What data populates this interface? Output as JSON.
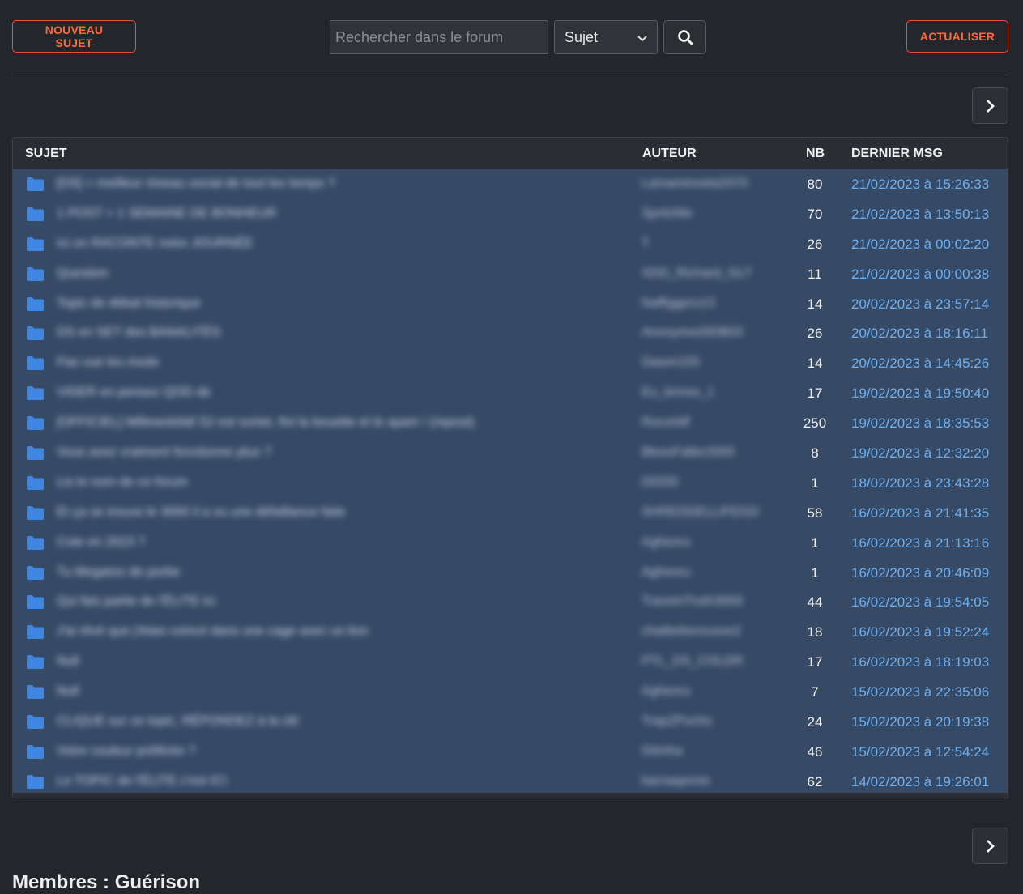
{
  "toolbar": {
    "new_topic_label": "Nouveau sujet",
    "search_placeholder": "Rechercher dans le forum",
    "search_select_value": "Sujet",
    "refresh_label": "Actualiser"
  },
  "table": {
    "headers": {
      "subject": "Sujet",
      "author": "Auteur",
      "count": "NB",
      "last": "Dernier MSG"
    },
    "rows": [
      {
        "subject": "[DS] = meilleur réseau social de tout les temps ?",
        "author": "Lamaminnela2070",
        "count": "80",
        "last": "21/02/2023 à 15:26:33"
      },
      {
        "subject": "1 POST = 1 SEMAINE DE BONHEUR",
        "author": "SpritzMe",
        "count": "70",
        "last": "21/02/2023 à 13:50:13"
      },
      {
        "subject": "Ici on RACONTE notre JOURNÉE",
        "author": "T",
        "count": "26",
        "last": "21/02/2023 à 00:02:20"
      },
      {
        "subject": "Question",
        "author": "XDD_Richard_GLT",
        "count": "11",
        "last": "21/02/2023 à 00:00:38"
      },
      {
        "subject": "Topic de débat historique",
        "author": "Naffiggers13",
        "count": "14",
        "last": "20/02/2023 à 23:57:14"
      },
      {
        "subject": "DS en SET des BANALITÉS",
        "author": "Anonymed3DB03",
        "count": "26",
        "last": "20/02/2023 à 18:16:11"
      },
      {
        "subject": "Pas vue les mods",
        "author": "Dawm155",
        "count": "14",
        "last": "20/02/2023 à 14:45:26"
      },
      {
        "subject": "VIDER en pensez QOD de",
        "author": "Eu_brmss_1",
        "count": "17",
        "last": "19/02/2023 à 19:50:40"
      },
      {
        "subject": "[OFFICIEL] Millewolsfall S2 est sortet, fini la bouette et le spam ! (repost)",
        "author": "Rocorldf",
        "count": "250",
        "last": "19/02/2023 à 18:35:53"
      },
      {
        "subject": "Vous avez vraiment fonctionne plus ?",
        "author": "BlessFaller2000",
        "count": "8",
        "last": "19/02/2023 à 12:32:20"
      },
      {
        "subject": "Lis le nom de ce forum",
        "author": "DDDD",
        "count": "1",
        "last": "18/02/2023 à 23:43:28"
      },
      {
        "subject": "Et ça se trouve le 3000 il a vu une défaillance faite",
        "author": "SHREDDELLIFEGD",
        "count": "58",
        "last": "16/02/2023 à 21:41:35"
      },
      {
        "subject": "Cote en 2023 ?",
        "author": "Agheoru",
        "count": "1",
        "last": "16/02/2023 à 21:13:16"
      },
      {
        "subject": "Tu Megatoo de porbe",
        "author": "Agheoru",
        "count": "1",
        "last": "16/02/2023 à 20:46:09"
      },
      {
        "subject": "Qui fais partie de l'ÉLITE ici",
        "author": "TraveinTruth3000",
        "count": "44",
        "last": "16/02/2023 à 19:54:05"
      },
      {
        "subject": "J'ai rêvé que j'étais coincé dans une cage avec un lion",
        "author": "chatbeberousse2",
        "count": "18",
        "last": "16/02/2023 à 19:52:24"
      },
      {
        "subject": "Null",
        "author": "PTL_DS_COLDR",
        "count": "17",
        "last": "16/02/2023 à 18:19:03"
      },
      {
        "subject": "Null",
        "author": "Agheoru",
        "count": "7",
        "last": "15/02/2023 à 22:35:06"
      },
      {
        "subject": "CLIQUE sur ce topic, RÉPONDEZ à la clé",
        "author": "TrapZPocho",
        "count": "24",
        "last": "15/02/2023 à 20:19:38"
      },
      {
        "subject": "Votre couleur préférée ?",
        "author": "Glimha",
        "count": "46",
        "last": "15/02/2023 à 12:54:24"
      },
      {
        "subject": "Le TOPIC de l'ÉLITE c'est ICI",
        "author": "barnaqemie",
        "count": "62",
        "last": "14/02/2023 à 19:26:01"
      }
    ]
  },
  "footer": {
    "title": "Membres : Guérison"
  },
  "colors": {
    "accent": "#ff6a3d",
    "link": "#6fb0f0",
    "folder": "#3f86e0"
  },
  "icons": {
    "search": "search-icon",
    "next": "chevron-right-icon",
    "folder": "folder-icon",
    "dropdown": "chevron-down-icon"
  }
}
